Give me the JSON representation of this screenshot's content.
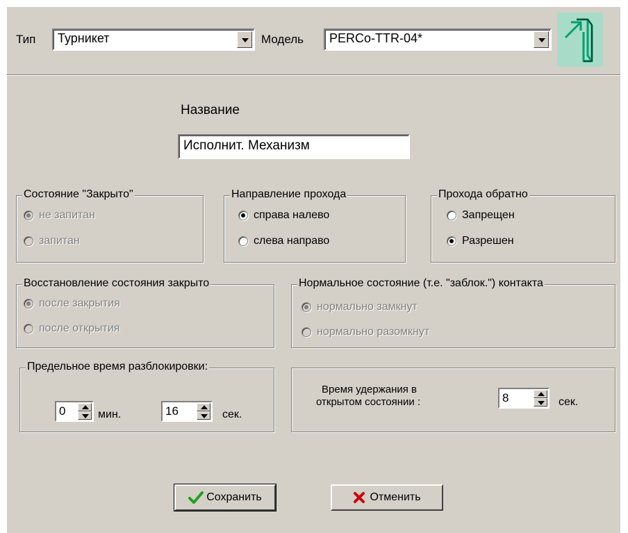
{
  "header": {
    "type_label": "Тип",
    "type_value": "Турникет",
    "model_label": "Модель",
    "model_value": "PERCo-TTR-04*",
    "device_icon": "turnstile-icon"
  },
  "name_section": {
    "label": "Название",
    "value": "Исполнит. Механизм"
  },
  "groups": {
    "closed_state": {
      "title": "Состояние \"Закрыто\"",
      "options": [
        "не запитан",
        "запитан"
      ],
      "selected": 0,
      "enabled": false
    },
    "direction": {
      "title": "Направление прохода",
      "options": [
        "справа налево",
        "слева направо"
      ],
      "selected": 0,
      "enabled": true
    },
    "reverse_pass": {
      "title": "Прохода обратно",
      "options": [
        "Запрещен",
        "Разрешен"
      ],
      "selected": 1,
      "enabled": true
    },
    "restore_closed": {
      "title": "Восстановление состояния закрыто",
      "options": [
        "после закрытия",
        "после открытия"
      ],
      "selected": 0,
      "enabled": false
    },
    "normal_contact": {
      "title": "Нормальное состояние (т.е. \"заблок.\") контакта",
      "options": [
        "нормально замкнут",
        "нормально разомкнут"
      ],
      "selected": 0,
      "enabled": false
    },
    "unlock_limit": {
      "title": "Предельное время разблокировки:",
      "minutes_value": "0",
      "minutes_unit": "мин.",
      "seconds_value": "16",
      "seconds_unit": "сек."
    },
    "hold_time": {
      "label_line1": "Время удержания в",
      "label_line2": "открытом состоянии :",
      "value": "8",
      "unit": "сек."
    }
  },
  "buttons": {
    "save_label": "Сохранить",
    "cancel_label": "Отменить"
  },
  "colors": {
    "window_bg": "#d4d0c8",
    "icon_bg": "#a8dcc8",
    "icon_stroke": "#00a070",
    "check_green": "#1fa01f",
    "cancel_red": "#cc0000"
  }
}
